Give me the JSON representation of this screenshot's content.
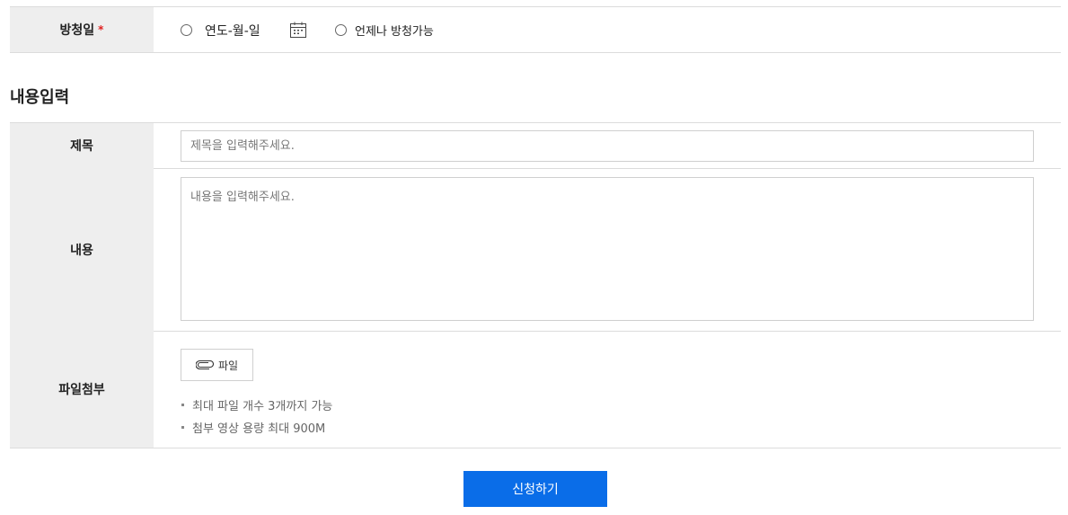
{
  "broadcast_date": {
    "label": "방청일",
    "required_mark": "*",
    "date_option_label": "연도-월-일",
    "anytime_option_label": "언제나 방청가능",
    "calendar_icon": "calendar-icon"
  },
  "section": {
    "title": "내용입력"
  },
  "title_field": {
    "label": "제목",
    "placeholder": "제목을 입력해주세요.",
    "value": ""
  },
  "content_field": {
    "label": "내용",
    "placeholder": "내용을 입력해주세요.",
    "value": ""
  },
  "attachment": {
    "label": "파일첨부",
    "button_label": "파일",
    "button_icon": "paperclip-icon",
    "notes": [
      "최대 파일 개수 3개까지 가능",
      "첨부 영상 용량 최대 900M"
    ]
  },
  "submit": {
    "label": "신청하기"
  },
  "colors": {
    "accent": "#0a6de8",
    "required": "#e02020",
    "header_bg": "#eeeeee",
    "border": "#dcdcdc"
  }
}
